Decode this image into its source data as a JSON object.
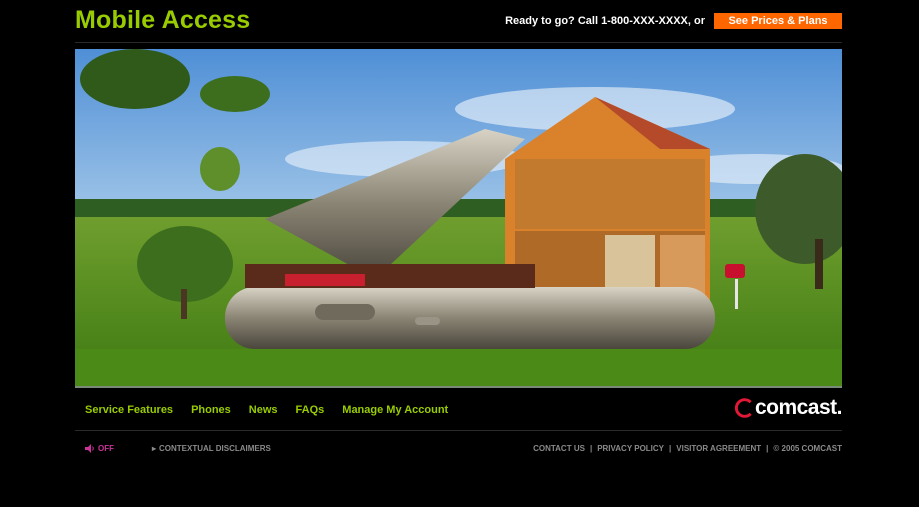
{
  "header": {
    "title": "Mobile Access",
    "cta_text": "Ready to go? Call 1-800-XXX-XXXX, or",
    "cta_button": "See Prices & Plans"
  },
  "hero": {
    "icon": "phone-house-illustration"
  },
  "nav": {
    "items": [
      {
        "label": "Service Features"
      },
      {
        "label": "Phones"
      },
      {
        "label": "News"
      },
      {
        "label": "FAQs"
      },
      {
        "label": "Manage My Account"
      }
    ]
  },
  "brand": {
    "name": "comcast",
    "mark": "."
  },
  "footer": {
    "sound_label": "OFF",
    "disclaimers": "CONTEXTUAL DISCLAIMERS",
    "links": [
      {
        "label": "CONTACT US"
      },
      {
        "label": "PRIVACY POLICY"
      },
      {
        "label": "VISITOR AGREEMENT"
      },
      {
        "label": "© 2005 COMCAST"
      }
    ],
    "separator": "|"
  },
  "colors": {
    "accent": "#99cc00",
    "cta": "#ff6600",
    "sound": "#cc3399",
    "muted": "#8a8a8a"
  }
}
